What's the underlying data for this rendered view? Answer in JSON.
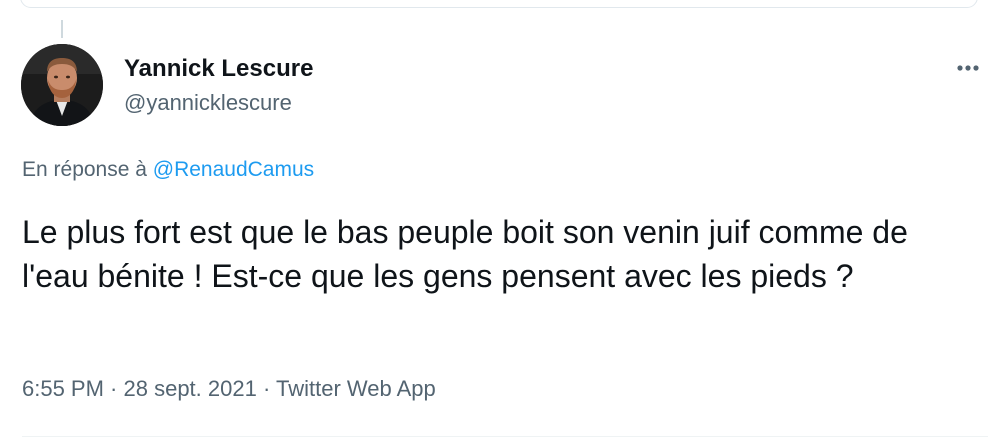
{
  "author": {
    "display_name": "Yannick Lescure",
    "handle": "@yannicklescure"
  },
  "reply": {
    "prefix": "En réponse à ",
    "mention": "@RenaudCamus"
  },
  "tweet": {
    "text": "Le plus fort est que le bas peuple boit son venin juif comme de l'eau bénite ! Est-ce que les gens pensent avec les pieds ?"
  },
  "meta": {
    "time": "6:55 PM",
    "separator": " · ",
    "date": "28 sept. 2021",
    "source": "Twitter Web App"
  },
  "icons": {
    "more": "more-horizontal-icon"
  },
  "colors": {
    "text": "#0f1419",
    "secondary": "#536471",
    "link": "#1d9bf0",
    "border": "#e1e8ed"
  }
}
